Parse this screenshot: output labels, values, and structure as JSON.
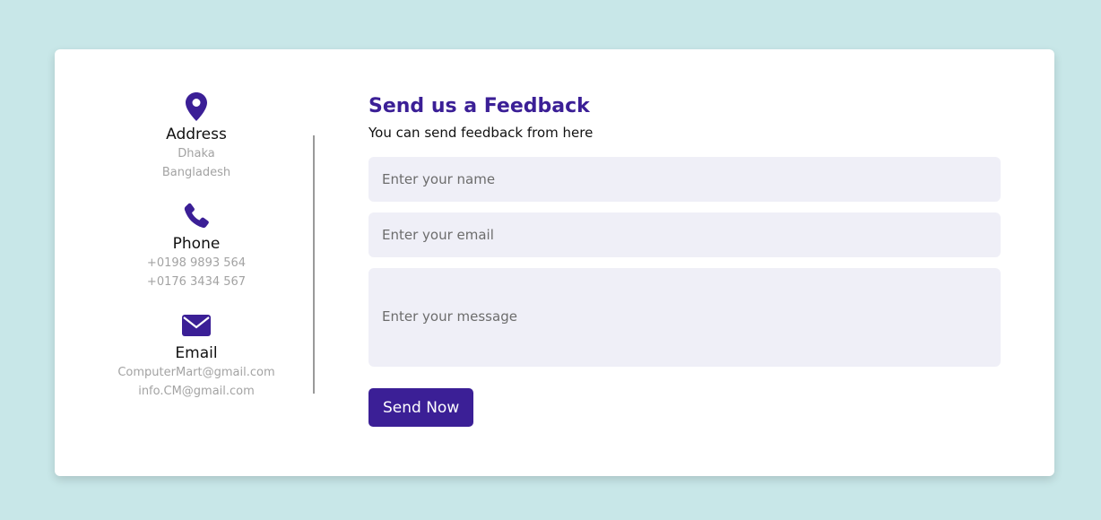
{
  "contact": {
    "address": {
      "icon": "map-pin-icon",
      "title": "Address",
      "lines": [
        "Dhaka",
        "Bangladesh"
      ]
    },
    "phone": {
      "icon": "phone-icon",
      "title": "Phone",
      "lines": [
        "+0198 9893 564",
        "+0176 3434 567"
      ]
    },
    "email": {
      "icon": "envelope-icon",
      "title": "Email",
      "lines": [
        "ComputerMart@gmail.com",
        "info.CM@gmail.com"
      ]
    }
  },
  "feedback": {
    "title": "Send us a Feedback",
    "subtitle": "You can send feedback from here",
    "name_placeholder": "Enter your name",
    "email_placeholder": "Enter your email",
    "message_placeholder": "Enter your message",
    "submit_label": "Send Now"
  },
  "colors": {
    "page_background": "#c8e7e8",
    "accent": "#3b1f96",
    "field_background": "#efeff7",
    "muted_text": "#a3a3a3"
  }
}
